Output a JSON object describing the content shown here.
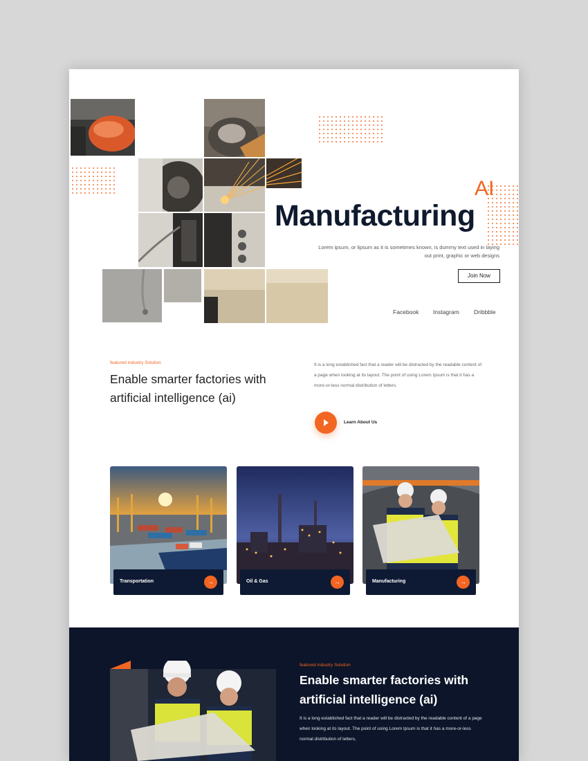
{
  "colors": {
    "accent": "#f26522",
    "navy": "#0c1529",
    "background": "#d7d7d7",
    "page": "#ffffff"
  },
  "hero": {
    "title_accent": "AI",
    "title": "Manufacturing",
    "description": "Lorem ipsum, or lipsum as it is sometimes known, is dummy text used in laying out print, graphic or web designs",
    "cta_label": "Join Now",
    "social": [
      "Facebook",
      "Instagram",
      "Dribbble"
    ]
  },
  "intro": {
    "eyebrow": "featured industry Solution",
    "title": "Enable smarter factories with artificial intelligence (ai)",
    "description": "It is a long established fact that a reader will be distracted by the readable content of a page when looking at its layout. The point of using Lorem Ipsum is that it has a more-or-less normal distribution of letters.",
    "link_label": "Learn About Us",
    "play_icon": "play-icon"
  },
  "cards": [
    {
      "label": "Transportation",
      "icon": "arrow-right-icon"
    },
    {
      "label": "Oil & Gas",
      "icon": "arrow-right-icon"
    },
    {
      "label": "Manufacturing",
      "icon": "arrow-right-icon"
    }
  ],
  "dark_section": {
    "eyebrow": "featured industry Solution",
    "title": "Enable smarter factories with artificial intelligence (ai)",
    "description": "It is a long established fact that a reader will be distracted by the readable content of a page when looking at its layout. The point of using Lorem Ipsum is that it has a more-or-less normal distribution of letters,"
  }
}
